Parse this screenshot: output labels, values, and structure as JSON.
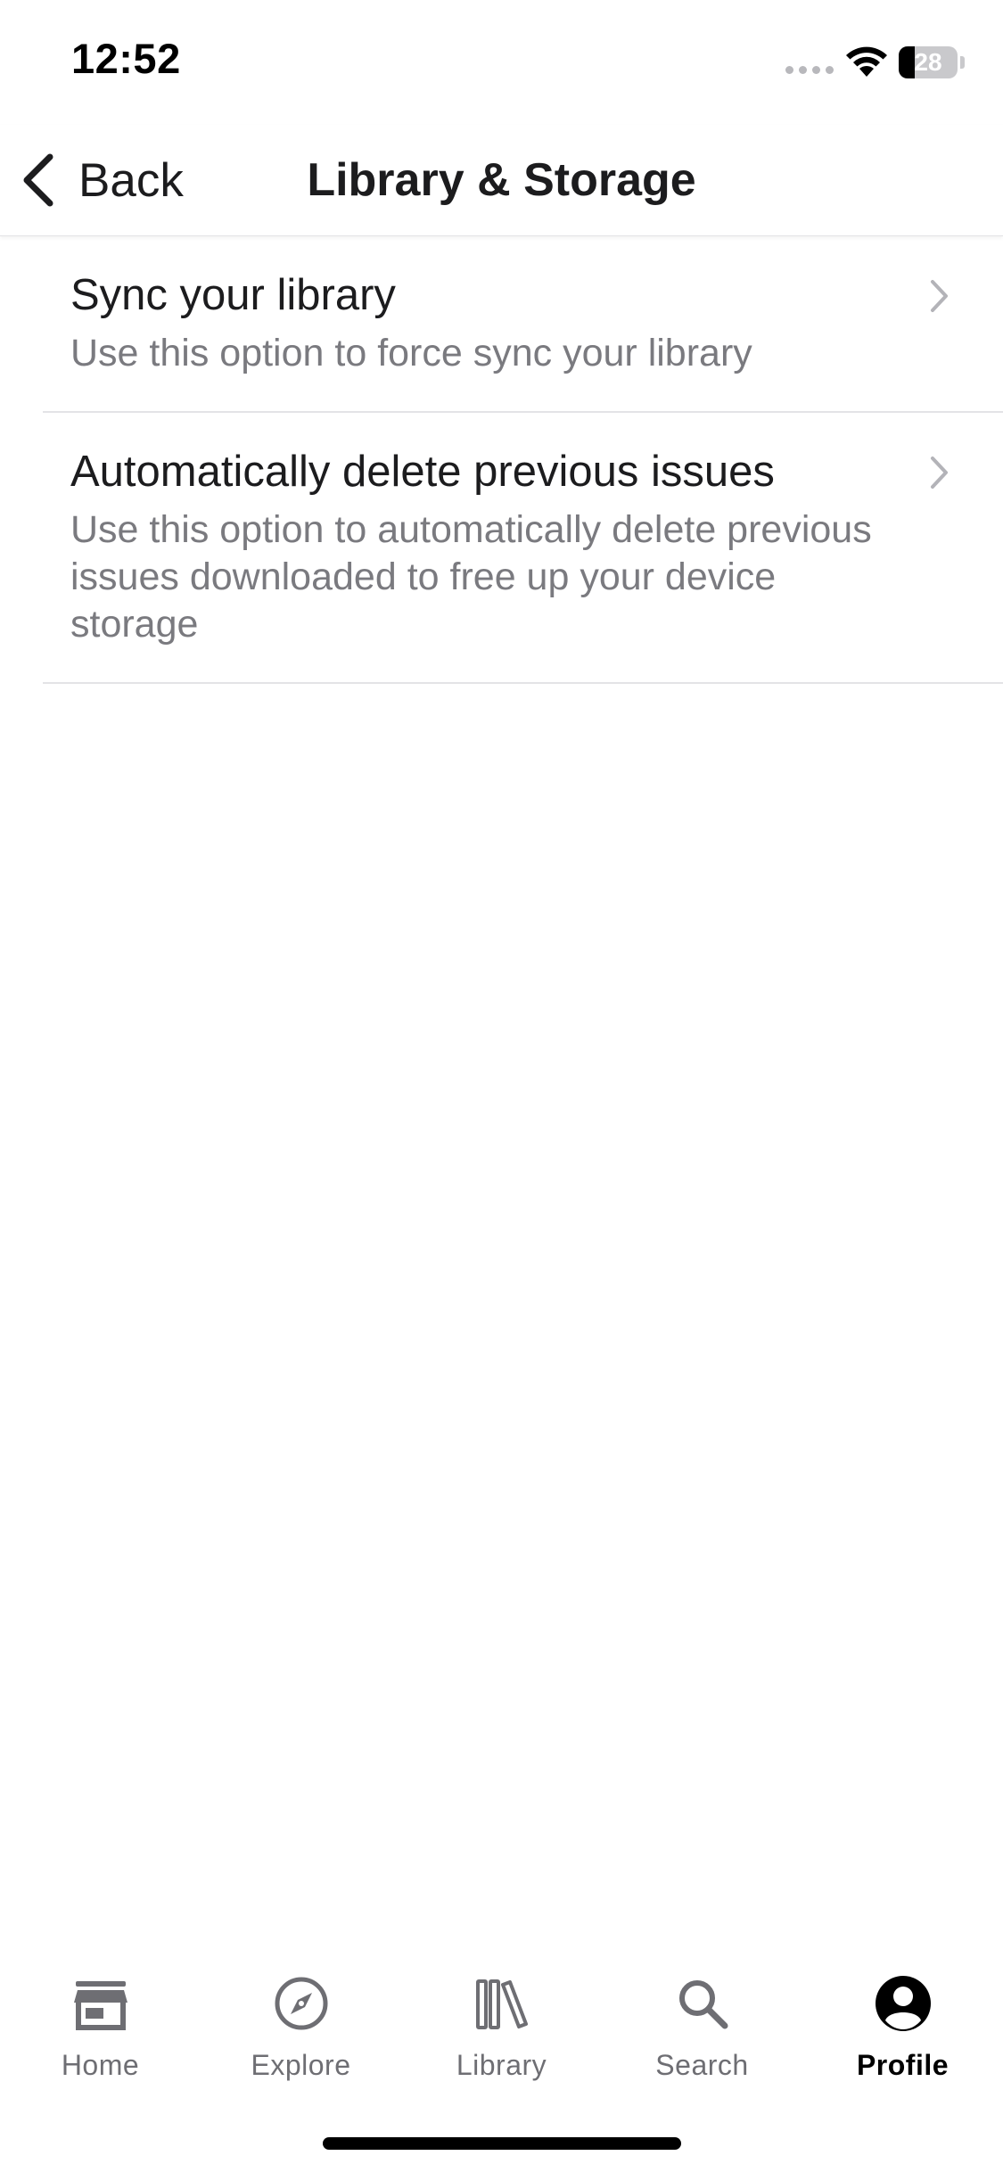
{
  "status_bar": {
    "time": "12:52",
    "battery_level": "28",
    "battery_fraction": 0.28,
    "icons": [
      "signal-icon",
      "wifi-icon",
      "battery-icon"
    ]
  },
  "nav": {
    "back_label": "Back",
    "title": "Library & Storage",
    "back_icon": "chevron-left-icon"
  },
  "settings": {
    "items": [
      {
        "title": "Sync your library",
        "subtitle": "Use this option to force sync your library",
        "icon": "chevron-right-icon"
      },
      {
        "title": "Automatically delete previous issues",
        "subtitle": "Use this option to automatically delete previous issues downloaded to free up your device storage",
        "icon": "chevron-right-icon"
      }
    ]
  },
  "tabbar": {
    "active": "Profile",
    "tabs": [
      {
        "label": "Home",
        "icon": "storefront-icon"
      },
      {
        "label": "Explore",
        "icon": "compass-icon"
      },
      {
        "label": "Library",
        "icon": "books-icon"
      },
      {
        "label": "Search",
        "icon": "magnifier-icon"
      },
      {
        "label": "Profile",
        "icon": "account-circle-icon"
      }
    ]
  },
  "colors": {
    "text_primary": "#1c1c1e",
    "text_secondary": "#7a7a7f",
    "tab_inactive": "#6e6e73",
    "tab_active": "#000000",
    "divider": "#e3e3e6",
    "chevron": "#b3b3b8"
  }
}
